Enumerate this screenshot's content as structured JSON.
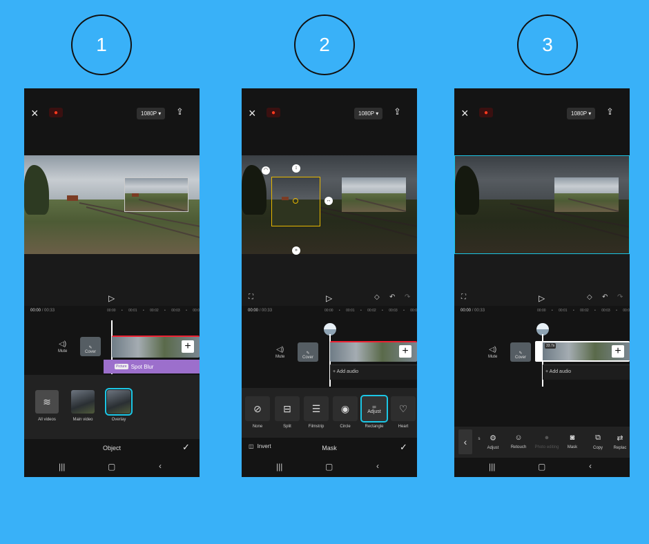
{
  "steps": [
    "1",
    "2",
    "3"
  ],
  "common": {
    "close_icon": "×",
    "resolution": "1080P ▾",
    "export_icon": "⇪",
    "play_icon": "▷",
    "time_current": "00:00",
    "time_total": "/ 00:33",
    "ticks": [
      "00:00",
      "•",
      "00:01",
      "•",
      "00:02",
      "•",
      "00:03",
      "•",
      "00:0"
    ],
    "mute_label": "Mute",
    "cover_label": "Cover",
    "add_label": "+",
    "nav": [
      "|||",
      "▢",
      "‹"
    ]
  },
  "screen1": {
    "effect_tag": "Picture",
    "effect_name": "Spot Blur",
    "objects": [
      {
        "label": "All videos",
        "icon": "stack-icon",
        "glyph": "≋"
      },
      {
        "label": "Main video",
        "icon": "thumbnail"
      },
      {
        "label": "Overlay",
        "icon": "thumbnail"
      }
    ],
    "bottom_title": "Object",
    "confirm_icon": "✓"
  },
  "screen2": {
    "add_audio": "+ Add audio",
    "masks": [
      {
        "label": "None",
        "glyph": "⊘"
      },
      {
        "label": "Split",
        "glyph": "⊟"
      },
      {
        "label": "Filmstrip",
        "glyph": "☰"
      },
      {
        "label": "Circle",
        "glyph": "◉"
      },
      {
        "label": "Rectangle",
        "glyph": "⚌",
        "caption": "Adjust"
      },
      {
        "label": "Heart",
        "glyph": "♡"
      }
    ],
    "invert_label": "Invert",
    "invert_icon": "◫",
    "bottom_title": "Mask",
    "confirm_icon": "✓",
    "fullscreen_icon": "⛶",
    "keyframe_icon": "◇",
    "undo_icon": "↶",
    "redo_icon": "↷"
  },
  "screen3": {
    "add_audio": "+ Add audio",
    "clip_duration": "33.7s",
    "back_icon": "‹",
    "tools": [
      {
        "label": "s",
        "glyph": ""
      },
      {
        "label": "Adjust",
        "glyph": "⚙"
      },
      {
        "label": "Retouch",
        "glyph": "☺"
      },
      {
        "label": "Photo editing",
        "glyph": "●",
        "disabled": true
      },
      {
        "label": "Mask",
        "glyph": "◙"
      },
      {
        "label": "Copy",
        "glyph": "⧉"
      },
      {
        "label": "Replac",
        "glyph": "⇄"
      }
    ]
  }
}
